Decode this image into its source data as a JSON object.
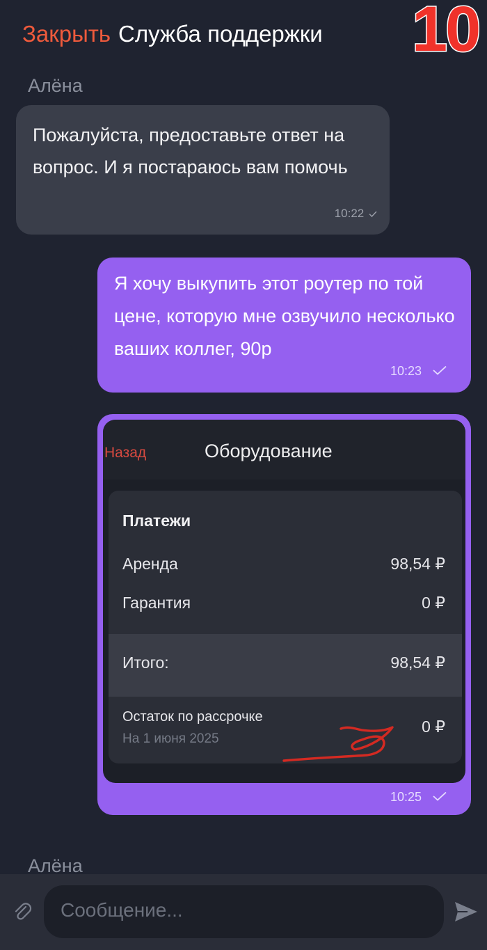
{
  "header": {
    "close_label": "Закрыть",
    "title": "Служба поддержки",
    "counter": "10"
  },
  "messages": [
    {
      "sender": "Алёна",
      "text": "Пожалуйста, предоставьте ответ на вопрос. И я постараюсь вам помочь",
      "time": "10:22"
    },
    {
      "text": "Я хочу выкупить этот роутер по той цене, которую мне озвучило несколько ваших коллег, 90р",
      "time": "10:23"
    },
    {
      "time": "10:25",
      "screenshot": {
        "back_label": "Назад",
        "title": "Оборудование",
        "heading": "Платежи",
        "rows": [
          {
            "label": "Аренда",
            "value": "98,54 ₽"
          },
          {
            "label": "Гарантия",
            "value": "0 ₽"
          }
        ],
        "total": {
          "label": "Итого:",
          "value": "98,54 ₽"
        },
        "installment": {
          "label": "Остаток по рассрочке",
          "note": "На 1 июня 2025",
          "value": "0 ₽"
        }
      }
    }
  ],
  "next_sender": "Алёна",
  "composer": {
    "placeholder": "Сообщение..."
  },
  "colors": {
    "background": "#1f2330",
    "outgoing_bubble": "#9560f0",
    "incoming_bubble": "#3a3e4a",
    "accent": "#ee5a3c"
  }
}
